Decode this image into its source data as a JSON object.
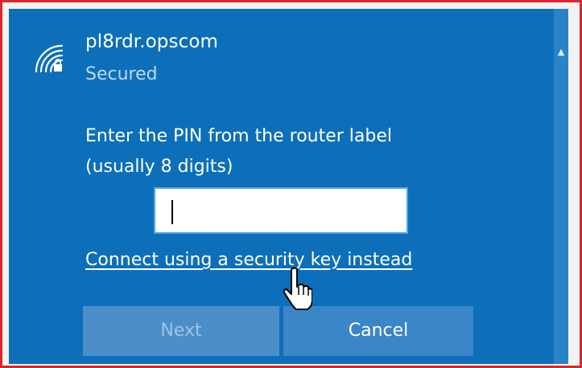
{
  "network": {
    "ssid": "pl8rdr.opscom",
    "status": "Secured",
    "icon": "wifi-secured-icon"
  },
  "pin_prompt": {
    "line1": "Enter the PIN from the router label",
    "line2": "(usually 8 digits)"
  },
  "pin_field": {
    "value": ""
  },
  "links": {
    "security_key": "Connect using a security key instead"
  },
  "buttons": {
    "next": "Next",
    "cancel": "Cancel"
  },
  "colors": {
    "panel_bg": "#0d6fb9",
    "frame_border": "#d9262b",
    "button_disabled": "#4c8ec9",
    "button_bg": "#3b86c8"
  }
}
